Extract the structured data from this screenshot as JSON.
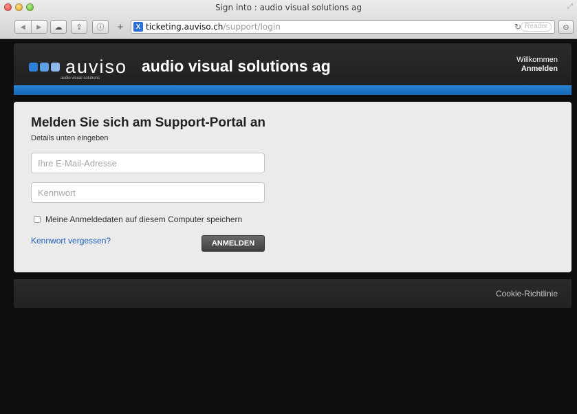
{
  "window": {
    "title": "Sign into : audio visual solutions ag"
  },
  "toolbar": {
    "back_glyph": "◀",
    "forward_glyph": "▶",
    "icloud_glyph": "☁",
    "share_glyph": "⇪",
    "reader_glyph": "ⓘ",
    "newtab_glyph": "+",
    "favicon_letter": "X",
    "url_host": "ticketing.auviso.ch",
    "url_path": "/support/login",
    "reload_glyph": "↻",
    "reader_label": "Reader",
    "download_glyph": "⊙"
  },
  "header": {
    "wordmark": "auviso",
    "tagline": "audio visual solutions",
    "company_name": "audio visual solutions ag",
    "welcome": "Willkommen",
    "login_link": "Anmelden"
  },
  "login": {
    "heading": "Melden Sie sich am Support-Portal an",
    "subtitle": "Details unten eingeben",
    "email_placeholder": "Ihre E-Mail-Adresse",
    "password_placeholder": "Kennwort",
    "remember_label": "Meine Anmeldedaten auf diesem Computer speichern",
    "forgot_link": "Kennwort vergessen?",
    "submit_label": "ANMELDEN"
  },
  "footer": {
    "cookie_link": "Cookie-Richtlinie"
  },
  "colors": {
    "accent_blue": "#1667b6",
    "page_background": "#0e0e0e",
    "card_background": "#ebebeb"
  }
}
